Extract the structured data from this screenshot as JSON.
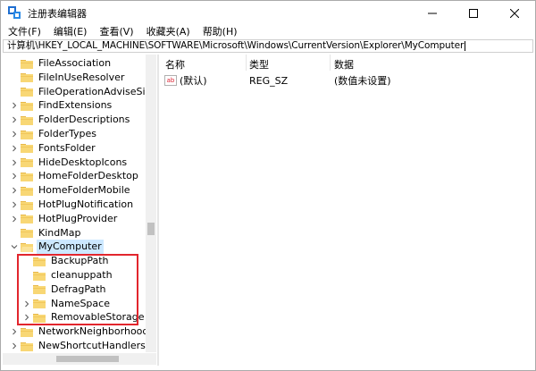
{
  "window": {
    "title": "注册表编辑器",
    "controls": {
      "minimize": "—",
      "maximize": "☐",
      "close": "✕"
    }
  },
  "menu": [
    "文件(F)",
    "编辑(E)",
    "查看(V)",
    "收藏夹(A)",
    "帮助(H)"
  ],
  "address": {
    "path": "计算机\\HKEY_LOCAL_MACHINE\\SOFTWARE\\Microsoft\\Windows\\CurrentVersion\\Explorer\\MyComputer"
  },
  "tree": {
    "nodes": [
      {
        "label": "FileAssociation",
        "expandable": false,
        "expanded": false,
        "level": 1
      },
      {
        "label": "FileInUseResolver",
        "expandable": false,
        "expanded": false,
        "level": 1
      },
      {
        "label": "FileOperationAdviseSinks",
        "expandable": false,
        "expanded": false,
        "level": 1
      },
      {
        "label": "FindExtensions",
        "expandable": true,
        "expanded": false,
        "level": 1
      },
      {
        "label": "FolderDescriptions",
        "expandable": true,
        "expanded": false,
        "level": 1
      },
      {
        "label": "FolderTypes",
        "expandable": true,
        "expanded": false,
        "level": 1
      },
      {
        "label": "FontsFolder",
        "expandable": true,
        "expanded": false,
        "level": 1
      },
      {
        "label": "HideDesktopIcons",
        "expandable": true,
        "expanded": false,
        "level": 1
      },
      {
        "label": "HomeFolderDesktop",
        "expandable": true,
        "expanded": false,
        "level": 1
      },
      {
        "label": "HomeFolderMobile",
        "expandable": true,
        "expanded": false,
        "level": 1
      },
      {
        "label": "HotPlugNotification",
        "expandable": true,
        "expanded": false,
        "level": 1
      },
      {
        "label": "HotPlugProvider",
        "expandable": true,
        "expanded": false,
        "level": 1
      },
      {
        "label": "KindMap",
        "expandable": false,
        "expanded": false,
        "level": 1
      },
      {
        "label": "MyComputer",
        "expandable": true,
        "expanded": true,
        "level": 1,
        "selected": true
      },
      {
        "label": "BackupPath",
        "expandable": false,
        "expanded": false,
        "level": 2
      },
      {
        "label": "cleanuppath",
        "expandable": false,
        "expanded": false,
        "level": 2
      },
      {
        "label": "DefragPath",
        "expandable": false,
        "expanded": false,
        "level": 2
      },
      {
        "label": "NameSpace",
        "expandable": true,
        "expanded": false,
        "level": 2
      },
      {
        "label": "RemovableStorage",
        "expandable": true,
        "expanded": false,
        "level": 2
      },
      {
        "label": "NetworkNeighborhood",
        "expandable": true,
        "expanded": false,
        "level": 1
      },
      {
        "label": "NewShortcutHandlers",
        "expandable": true,
        "expanded": false,
        "level": 1
      }
    ]
  },
  "list": {
    "columns": {
      "name": "名称",
      "type": "类型",
      "data": "数据"
    },
    "rows": [
      {
        "icon": "ab",
        "name": "(默认)",
        "type": "REG_SZ",
        "data": "(数值未设置)"
      }
    ]
  },
  "colors": {
    "highlight": "#e2262d",
    "selection": "#cce8ff",
    "folder": "#f8d775"
  }
}
